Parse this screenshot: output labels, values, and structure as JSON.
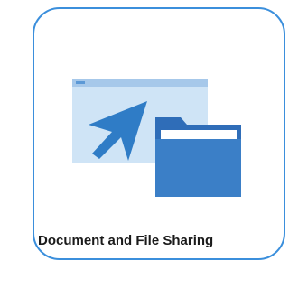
{
  "tile": {
    "label": "Document and File Sharing",
    "icon": "document-file-sharing-icon",
    "colors": {
      "border": "#3b8fdc",
      "window_light": "#cfe4f6",
      "window_bar": "#a6c8ea",
      "arrow": "#2f7cc6",
      "folder": "#3b7fc7"
    }
  }
}
